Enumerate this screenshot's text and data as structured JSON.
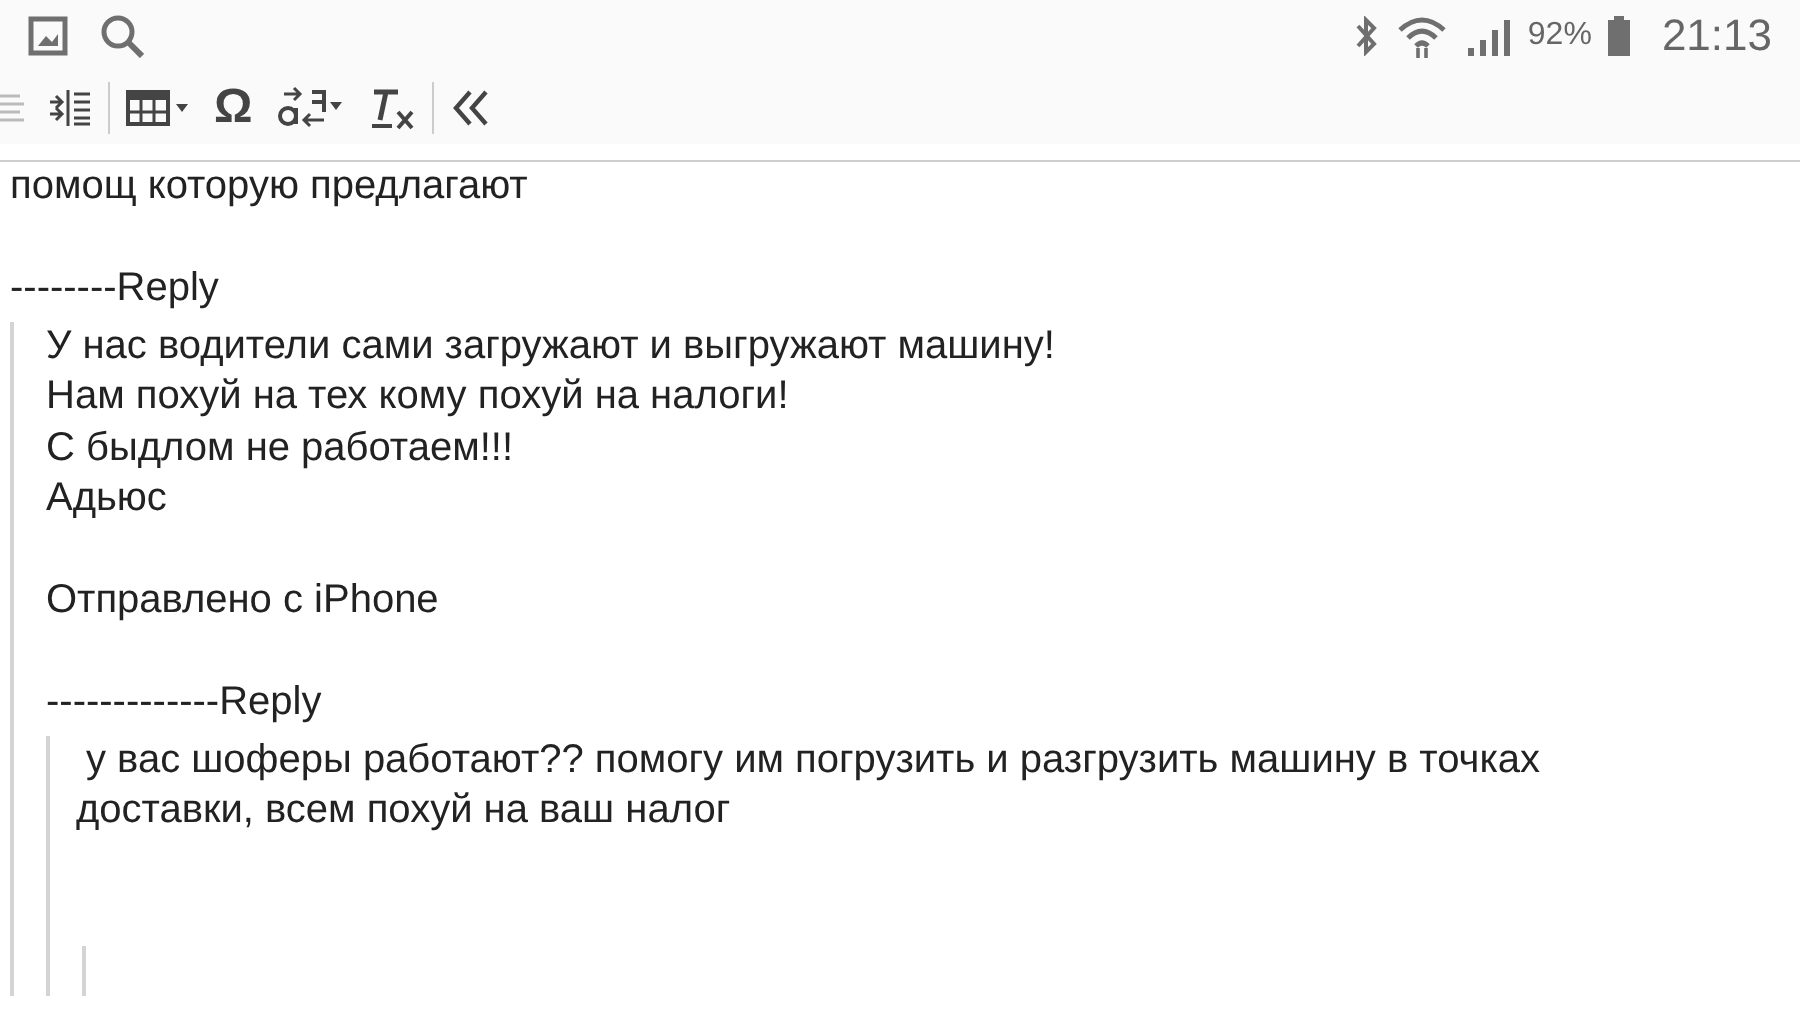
{
  "status_bar": {
    "left_icons": [
      {
        "kind": "picture"
      },
      {
        "kind": "search"
      }
    ],
    "battery": "92%",
    "time": "21:13"
  },
  "toolbar": {
    "items": [
      {
        "kind": "align"
      },
      {
        "kind": "indent"
      },
      {
        "kind": "table"
      },
      {
        "kind": "char",
        "label": "Ω"
      },
      {
        "kind": "direction"
      },
      {
        "kind": "clear-format"
      },
      {
        "kind": "collapse"
      }
    ]
  },
  "message": {
    "blocks": [
      {
        "kind": "line",
        "text": "помощ которую предлагают"
      },
      {
        "kind": "blank"
      },
      {
        "kind": "marker",
        "text": "--------Reply"
      },
      {
        "kind": "quote",
        "blocks": [
          {
            "kind": "line",
            "text": "У нас водители сами загружают и выгружают машину!"
          },
          {
            "kind": "line",
            "text": "Нам похуй на тех кому похуй на налоги!"
          },
          {
            "kind": "line",
            "text": "С быдлом не работаем!!!"
          },
          {
            "kind": "line",
            "text": "Адьюс"
          },
          {
            "kind": "blank"
          },
          {
            "kind": "line",
            "text": "Отправлено с iPhone"
          },
          {
            "kind": "blank"
          },
          {
            "kind": "marker",
            "text": "-------------Reply"
          },
          {
            "kind": "quote",
            "blocks": [
              {
                "kind": "paragraph",
                "text": "у вас шоферы работают?? помогу им погрузить и разгрузить машину в точках доставки, всем похуй на ваш налог"
              },
              {
                "kind": "blank"
              },
              {
                "kind": "blank"
              },
              {
                "kind": "quote",
                "blocks": [
                  {
                    "kind": "blank"
                  }
                ]
              }
            ]
          }
        ]
      }
    ]
  }
}
